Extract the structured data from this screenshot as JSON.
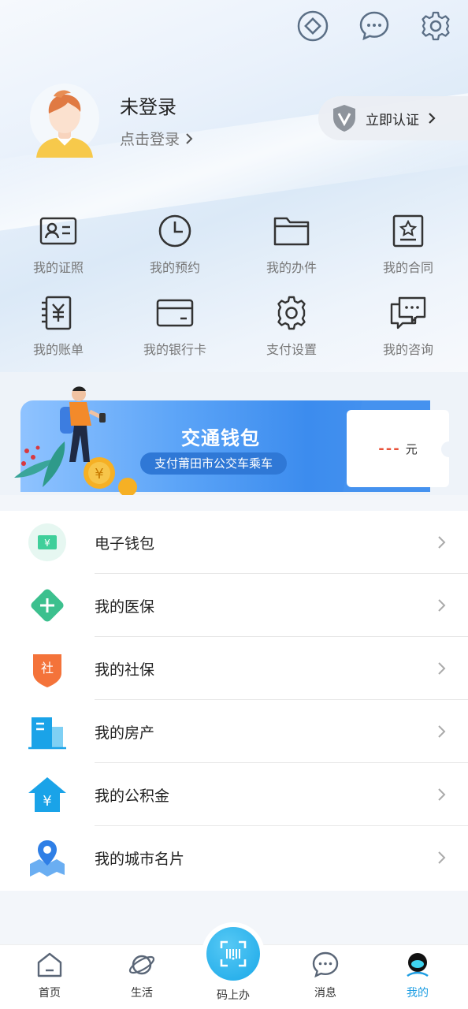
{
  "header": {
    "login_title": "未登录",
    "login_sub": "点击登录",
    "verify_label": "立即认证"
  },
  "grid": [
    {
      "label": "我的证照",
      "icon": "id-card-icon"
    },
    {
      "label": "我的预约",
      "icon": "clock-icon"
    },
    {
      "label": "我的办件",
      "icon": "folder-icon"
    },
    {
      "label": "我的合同",
      "icon": "contract-icon"
    },
    {
      "label": "我的账单",
      "icon": "bill-icon"
    },
    {
      "label": "我的银行卡",
      "icon": "bank-card-icon"
    },
    {
      "label": "支付设置",
      "icon": "settings-icon"
    },
    {
      "label": "我的咨询",
      "icon": "chat-icon"
    }
  ],
  "banner": {
    "title": "交通钱包",
    "subtitle": "支付莆田市公交车乘车",
    "amount": "---",
    "unit": "元"
  },
  "list": [
    {
      "label": "电子钱包",
      "icon": "wallet-icon"
    },
    {
      "label": "我的医保",
      "icon": "medical-icon"
    },
    {
      "label": "我的社保",
      "icon": "social-security-icon"
    },
    {
      "label": "我的房产",
      "icon": "building-icon"
    },
    {
      "label": "我的公积金",
      "icon": "housing-fund-icon"
    },
    {
      "label": "我的城市名片",
      "icon": "map-pin-icon"
    }
  ],
  "tabs": [
    {
      "label": "首页",
      "icon": "home-icon"
    },
    {
      "label": "生活",
      "icon": "planet-icon"
    },
    {
      "label": "码上办",
      "icon": "scan-icon"
    },
    {
      "label": "消息",
      "icon": "message-icon"
    },
    {
      "label": "我的",
      "icon": "profile-icon"
    }
  ],
  "colors": {
    "accent": "#1d9de2",
    "amount": "#e8523a",
    "icon_stroke": "#333333"
  }
}
